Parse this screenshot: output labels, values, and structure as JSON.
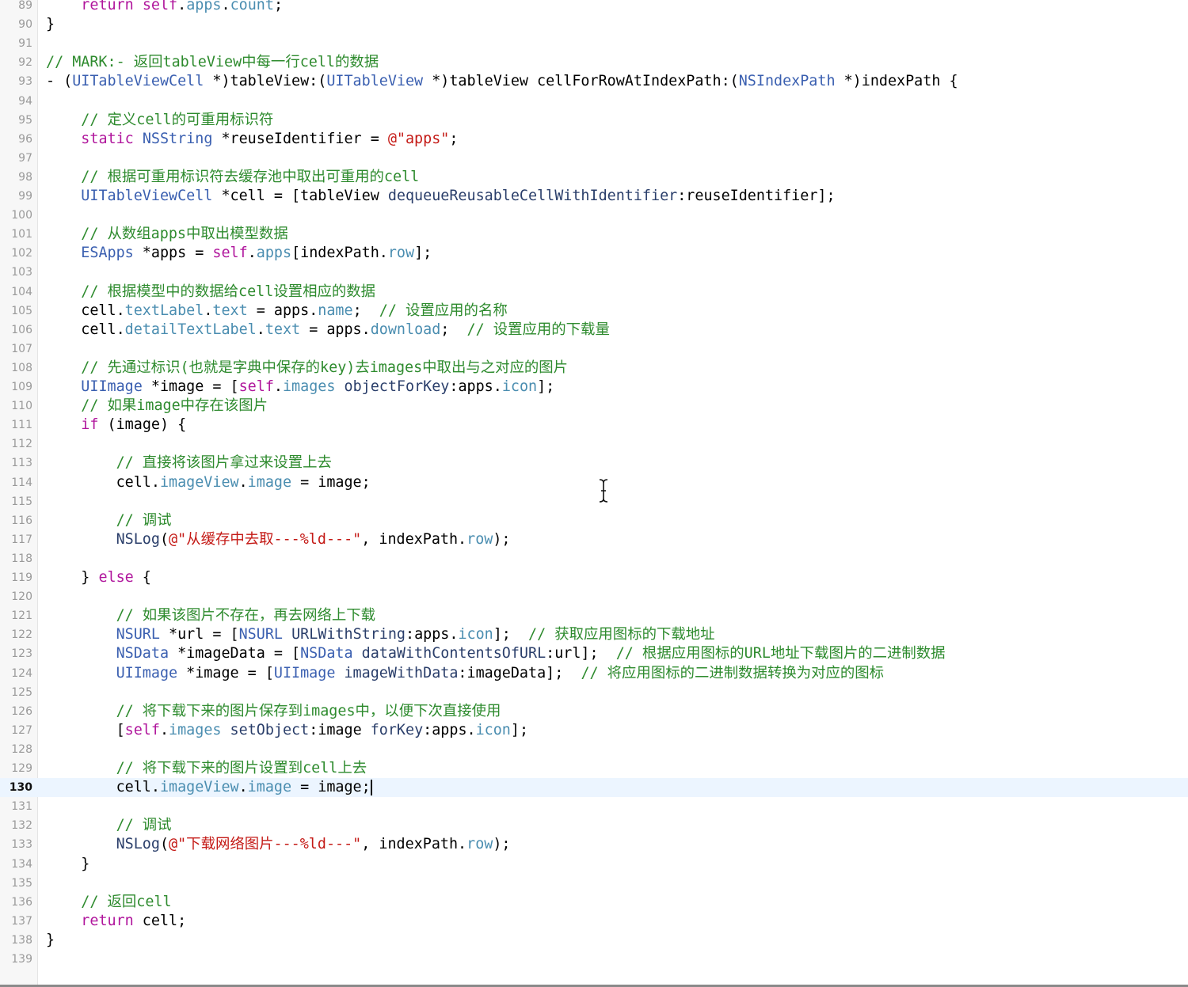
{
  "editor": {
    "current_line": 130,
    "lines": [
      {
        "n": "89",
        "tokens": [
          [
            "",
            "    "
          ],
          [
            "kw",
            "return"
          ],
          [
            "",
            " "
          ],
          [
            "kw",
            "self"
          ],
          [
            "",
            "."
          ],
          [
            "prop",
            "apps"
          ],
          [
            "",
            "."
          ],
          [
            "prop",
            "count"
          ],
          [
            "",
            ";"
          ]
        ]
      },
      {
        "n": "90",
        "tokens": [
          [
            "",
            "}"
          ]
        ]
      },
      {
        "n": "91",
        "tokens": []
      },
      {
        "n": "92",
        "tokens": [
          [
            "comment",
            "// MARK:- 返回tableView中每一行cell的数据"
          ]
        ]
      },
      {
        "n": "93",
        "tokens": [
          [
            "",
            "- ("
          ],
          [
            "type",
            "UITableViewCell"
          ],
          [
            "",
            " *)tableView:("
          ],
          [
            "type",
            "UITableView"
          ],
          [
            "",
            " *)tableView cellForRowAtIndexPath:("
          ],
          [
            "type",
            "NSIndexPath"
          ],
          [
            "",
            " *)indexPath {"
          ]
        ]
      },
      {
        "n": "94",
        "tokens": []
      },
      {
        "n": "95",
        "tokens": [
          [
            "",
            "    "
          ],
          [
            "comment",
            "// 定义cell的可重用标识符"
          ]
        ]
      },
      {
        "n": "96",
        "tokens": [
          [
            "",
            "    "
          ],
          [
            "kw",
            "static"
          ],
          [
            "",
            " "
          ],
          [
            "type",
            "NSString"
          ],
          [
            "",
            " *reuseIdentifier = "
          ],
          [
            "str",
            "@\"apps\""
          ],
          [
            "",
            ";"
          ]
        ]
      },
      {
        "n": "97",
        "tokens": []
      },
      {
        "n": "98",
        "tokens": [
          [
            "",
            "    "
          ],
          [
            "comment",
            "// 根据可重用标识符去缓存池中取出可重用的cell"
          ]
        ]
      },
      {
        "n": "99",
        "tokens": [
          [
            "",
            "    "
          ],
          [
            "type",
            "UITableViewCell"
          ],
          [
            "",
            " *cell = [tableView "
          ],
          [
            "method",
            "dequeueReusableCellWithIdentifier"
          ],
          [
            "",
            ":reuseIdentifier];"
          ]
        ]
      },
      {
        "n": "100",
        "tokens": []
      },
      {
        "n": "101",
        "tokens": [
          [
            "",
            "    "
          ],
          [
            "comment",
            "// 从数组apps中取出模型数据"
          ]
        ]
      },
      {
        "n": "102",
        "tokens": [
          [
            "",
            "    "
          ],
          [
            "type",
            "ESApps"
          ],
          [
            "",
            " *apps = "
          ],
          [
            "kw",
            "self"
          ],
          [
            "",
            "."
          ],
          [
            "prop",
            "apps"
          ],
          [
            "",
            "[indexPath."
          ],
          [
            "prop",
            "row"
          ],
          [
            "",
            "];"
          ]
        ]
      },
      {
        "n": "103",
        "tokens": []
      },
      {
        "n": "104",
        "tokens": [
          [
            "",
            "    "
          ],
          [
            "comment",
            "// 根据模型中的数据给cell设置相应的数据"
          ]
        ]
      },
      {
        "n": "105",
        "tokens": [
          [
            "",
            "    cell."
          ],
          [
            "prop",
            "textLabel"
          ],
          [
            "",
            "."
          ],
          [
            "prop",
            "text"
          ],
          [
            "",
            " = apps."
          ],
          [
            "prop",
            "name"
          ],
          [
            "",
            ";  "
          ],
          [
            "comment",
            "// 设置应用的名称"
          ]
        ]
      },
      {
        "n": "106",
        "tokens": [
          [
            "",
            "    cell."
          ],
          [
            "prop",
            "detailTextLabel"
          ],
          [
            "",
            "."
          ],
          [
            "prop",
            "text"
          ],
          [
            "",
            " = apps."
          ],
          [
            "prop",
            "download"
          ],
          [
            "",
            ";  "
          ],
          [
            "comment",
            "// 设置应用的下载量"
          ]
        ]
      },
      {
        "n": "107",
        "tokens": []
      },
      {
        "n": "108",
        "tokens": [
          [
            "",
            "    "
          ],
          [
            "comment",
            "// 先通过标识(也就是字典中保存的key)去images中取出与之对应的图片"
          ]
        ]
      },
      {
        "n": "109",
        "tokens": [
          [
            "",
            "    "
          ],
          [
            "type",
            "UIImage"
          ],
          [
            "",
            " *image = ["
          ],
          [
            "kw",
            "self"
          ],
          [
            "",
            "."
          ],
          [
            "prop",
            "images"
          ],
          [
            "",
            " "
          ],
          [
            "method",
            "objectForKey"
          ],
          [
            "",
            ":apps."
          ],
          [
            "prop",
            "icon"
          ],
          [
            "",
            "];"
          ]
        ]
      },
      {
        "n": "110",
        "tokens": [
          [
            "",
            "    "
          ],
          [
            "comment",
            "// 如果image中存在该图片"
          ]
        ]
      },
      {
        "n": "111",
        "tokens": [
          [
            "",
            "    "
          ],
          [
            "kw",
            "if"
          ],
          [
            "",
            " (image) {"
          ]
        ]
      },
      {
        "n": "112",
        "tokens": []
      },
      {
        "n": "113",
        "tokens": [
          [
            "",
            "        "
          ],
          [
            "comment",
            "// 直接将该图片拿过来设置上去"
          ]
        ]
      },
      {
        "n": "114",
        "tokens": [
          [
            "",
            "        cell."
          ],
          [
            "prop",
            "imageView"
          ],
          [
            "",
            "."
          ],
          [
            "prop",
            "image"
          ],
          [
            "",
            " = image;"
          ]
        ]
      },
      {
        "n": "115",
        "tokens": []
      },
      {
        "n": "116",
        "tokens": [
          [
            "",
            "        "
          ],
          [
            "comment",
            "// 调试"
          ]
        ]
      },
      {
        "n": "117",
        "tokens": [
          [
            "",
            "        "
          ],
          [
            "method",
            "NSLog"
          ],
          [
            "",
            "("
          ],
          [
            "str",
            "@\"从缓存中去取---%ld---\""
          ],
          [
            "",
            ", indexPath."
          ],
          [
            "prop",
            "row"
          ],
          [
            "",
            ");"
          ]
        ]
      },
      {
        "n": "118",
        "tokens": []
      },
      {
        "n": "119",
        "tokens": [
          [
            "",
            "    } "
          ],
          [
            "kw",
            "else"
          ],
          [
            "",
            " {"
          ]
        ]
      },
      {
        "n": "120",
        "tokens": []
      },
      {
        "n": "121",
        "tokens": [
          [
            "",
            "        "
          ],
          [
            "comment",
            "// 如果该图片不存在，再去网络上下载"
          ]
        ]
      },
      {
        "n": "122",
        "tokens": [
          [
            "",
            "        "
          ],
          [
            "type",
            "NSURL"
          ],
          [
            "",
            " *url = ["
          ],
          [
            "type",
            "NSURL"
          ],
          [
            "",
            " "
          ],
          [
            "method",
            "URLWithString"
          ],
          [
            "",
            ":apps."
          ],
          [
            "prop",
            "icon"
          ],
          [
            "",
            "];  "
          ],
          [
            "comment",
            "// 获取应用图标的下载地址"
          ]
        ]
      },
      {
        "n": "123",
        "tokens": [
          [
            "",
            "        "
          ],
          [
            "type",
            "NSData"
          ],
          [
            "",
            " *imageData = ["
          ],
          [
            "type",
            "NSData"
          ],
          [
            "",
            " "
          ],
          [
            "method",
            "dataWithContentsOfURL"
          ],
          [
            "",
            ":url];  "
          ],
          [
            "comment",
            "// 根据应用图标的URL地址下载图片的二进制数据"
          ]
        ]
      },
      {
        "n": "124",
        "tokens": [
          [
            "",
            "        "
          ],
          [
            "type",
            "UIImage"
          ],
          [
            "",
            " *image = ["
          ],
          [
            "type",
            "UIImage"
          ],
          [
            "",
            " "
          ],
          [
            "method",
            "imageWithData"
          ],
          [
            "",
            ":imageData];  "
          ],
          [
            "comment",
            "// 将应用图标的二进制数据转换为对应的图标"
          ]
        ]
      },
      {
        "n": "125",
        "tokens": []
      },
      {
        "n": "126",
        "tokens": [
          [
            "",
            "        "
          ],
          [
            "comment",
            "// 将下载下来的图片保存到images中，以便下次直接使用"
          ]
        ]
      },
      {
        "n": "127",
        "tokens": [
          [
            "",
            "        ["
          ],
          [
            "kw",
            "self"
          ],
          [
            "",
            "."
          ],
          [
            "prop",
            "images"
          ],
          [
            "",
            " "
          ],
          [
            "method",
            "setObject"
          ],
          [
            "",
            ":image "
          ],
          [
            "method",
            "forKey"
          ],
          [
            "",
            ":apps."
          ],
          [
            "prop",
            "icon"
          ],
          [
            "",
            "];"
          ]
        ]
      },
      {
        "n": "128",
        "tokens": []
      },
      {
        "n": "129",
        "tokens": [
          [
            "",
            "        "
          ],
          [
            "comment",
            "// 将下载下来的图片设置到cell上去"
          ]
        ]
      },
      {
        "n": "130",
        "tokens": [
          [
            "",
            "        cell."
          ],
          [
            "prop",
            "imageView"
          ],
          [
            "",
            "."
          ],
          [
            "prop",
            "image"
          ],
          [
            "",
            " = image;"
          ]
        ]
      },
      {
        "n": "131",
        "tokens": []
      },
      {
        "n": "132",
        "tokens": [
          [
            "",
            "        "
          ],
          [
            "comment",
            "// 调试"
          ]
        ]
      },
      {
        "n": "133",
        "tokens": [
          [
            "",
            "        "
          ],
          [
            "method",
            "NSLog"
          ],
          [
            "",
            "("
          ],
          [
            "str",
            "@\"下载网络图片---%ld---\""
          ],
          [
            "",
            ", indexPath."
          ],
          [
            "prop",
            "row"
          ],
          [
            "",
            ");"
          ]
        ]
      },
      {
        "n": "134",
        "tokens": [
          [
            "",
            "    }"
          ]
        ]
      },
      {
        "n": "135",
        "tokens": []
      },
      {
        "n": "136",
        "tokens": [
          [
            "",
            "    "
          ],
          [
            "comment",
            "// 返回cell"
          ]
        ]
      },
      {
        "n": "137",
        "tokens": [
          [
            "",
            "    "
          ],
          [
            "kw",
            "return"
          ],
          [
            "",
            " cell;"
          ]
        ]
      },
      {
        "n": "138",
        "tokens": [
          [
            "",
            "}"
          ]
        ]
      },
      {
        "n": "139",
        "tokens": []
      }
    ]
  },
  "cursor": {
    "icon": "text-ibeam-cursor-icon"
  },
  "colors": {
    "keyword": "#b0159c",
    "type": "#3a5fb0",
    "property": "#4a8db0",
    "method": "#2a3e6a",
    "string": "#c41a16",
    "comment": "#2e8b2e",
    "current_line_bg": "#ecf5ff"
  }
}
